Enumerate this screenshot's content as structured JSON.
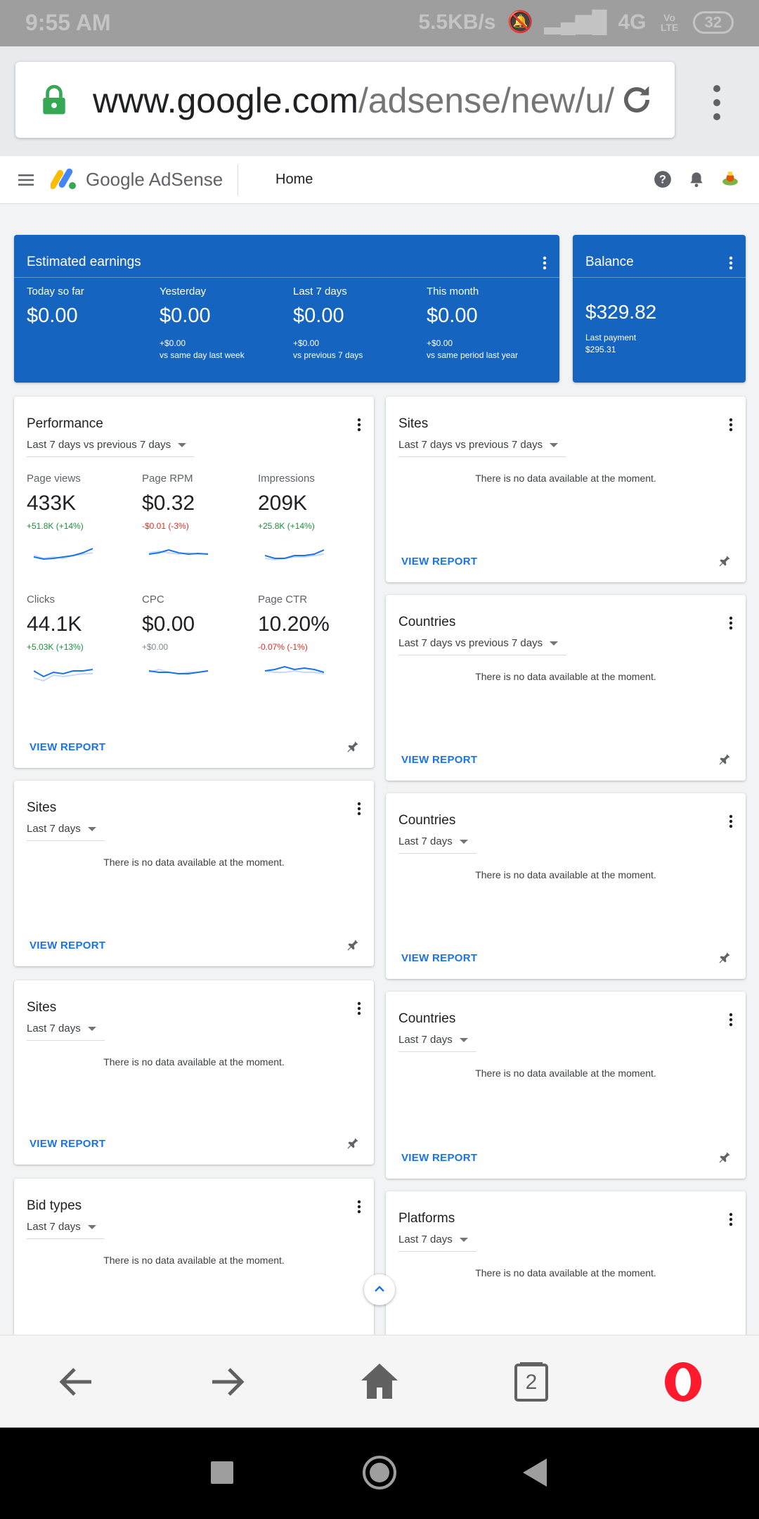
{
  "status_bar": {
    "time": "9:55 AM",
    "net_speed": "5.5KB/s",
    "network": "4G",
    "lte": "Vo LTE",
    "battery": "32"
  },
  "browser": {
    "url_domain": "www.google.com",
    "url_path": "/adsense/new/u/"
  },
  "header": {
    "brand": "Google AdSense",
    "page": "Home"
  },
  "estimated_earnings": {
    "title": "Estimated earnings",
    "columns": [
      {
        "label": "Today so far",
        "value": "$0.00",
        "delta": "",
        "compare": ""
      },
      {
        "label": "Yesterday",
        "value": "$0.00",
        "delta": "+$0.00",
        "compare": "vs same day last week"
      },
      {
        "label": "Last 7 days",
        "value": "$0.00",
        "delta": "+$0.00",
        "compare": "vs previous 7 days"
      },
      {
        "label": "This month",
        "value": "$0.00",
        "delta": "+$0.00",
        "compare": "vs same period last year"
      }
    ]
  },
  "balance": {
    "title": "Balance",
    "value": "$329.82",
    "last_payment_label": "Last payment",
    "last_payment_value": "$295.31"
  },
  "performance": {
    "title": "Performance",
    "range": "Last 7 days vs previous 7 days",
    "metrics": [
      {
        "label": "Page views",
        "value": "433K",
        "change": "+51.8K (+14%)",
        "trend": "up"
      },
      {
        "label": "Page RPM",
        "value": "$0.32",
        "change": "-$0.01 (-3%)",
        "trend": "down"
      },
      {
        "label": "Impressions",
        "value": "209K",
        "change": "+25.8K (+14%)",
        "trend": "up"
      },
      {
        "label": "Clicks",
        "value": "44.1K",
        "change": "+5.03K (+13%)",
        "trend": "up"
      },
      {
        "label": "CPC",
        "value": "$0.00",
        "change": "+$0.00",
        "trend": "flat"
      },
      {
        "label": "Page CTR",
        "value": "10.20%",
        "change": "-0.07% (-1%)",
        "trend": "down"
      }
    ],
    "view_report": "VIEW REPORT"
  },
  "cards": [
    {
      "title": "Sites",
      "range": "Last 7 days vs previous 7 days",
      "message": "There is no data available at the moment.",
      "view_report": "VIEW REPORT"
    },
    {
      "title": "Countries",
      "range": "Last 7 days vs previous 7 days",
      "message": "There is no data available at the moment.",
      "view_report": "VIEW REPORT"
    },
    {
      "title": "Sites",
      "range": "Last 7 days",
      "message": "There is no data available at the moment.",
      "view_report": "VIEW REPORT"
    },
    {
      "title": "Countries",
      "range": "Last 7 days",
      "message": "There is no data available at the moment.",
      "view_report": "VIEW REPORT"
    },
    {
      "title": "Sites",
      "range": "Last 7 days",
      "message": "There is no data available at the moment.",
      "view_report": "VIEW REPORT"
    },
    {
      "title": "Countries",
      "range": "Last 7 days",
      "message": "There is no data available at the moment.",
      "view_report": "VIEW REPORT"
    },
    {
      "title": "Bid types",
      "range": "Last 7 days",
      "message": "There is no data available at the moment."
    },
    {
      "title": "Platforms",
      "range": "Last 7 days",
      "message": "There is no data available at the moment."
    }
  ],
  "bottom_nav": {
    "tabs_count": "2"
  },
  "colors": {
    "primary_blue": "#1565c0",
    "link_blue": "#1a73e8",
    "positive": "#1e8e3e",
    "negative": "#d93025"
  }
}
